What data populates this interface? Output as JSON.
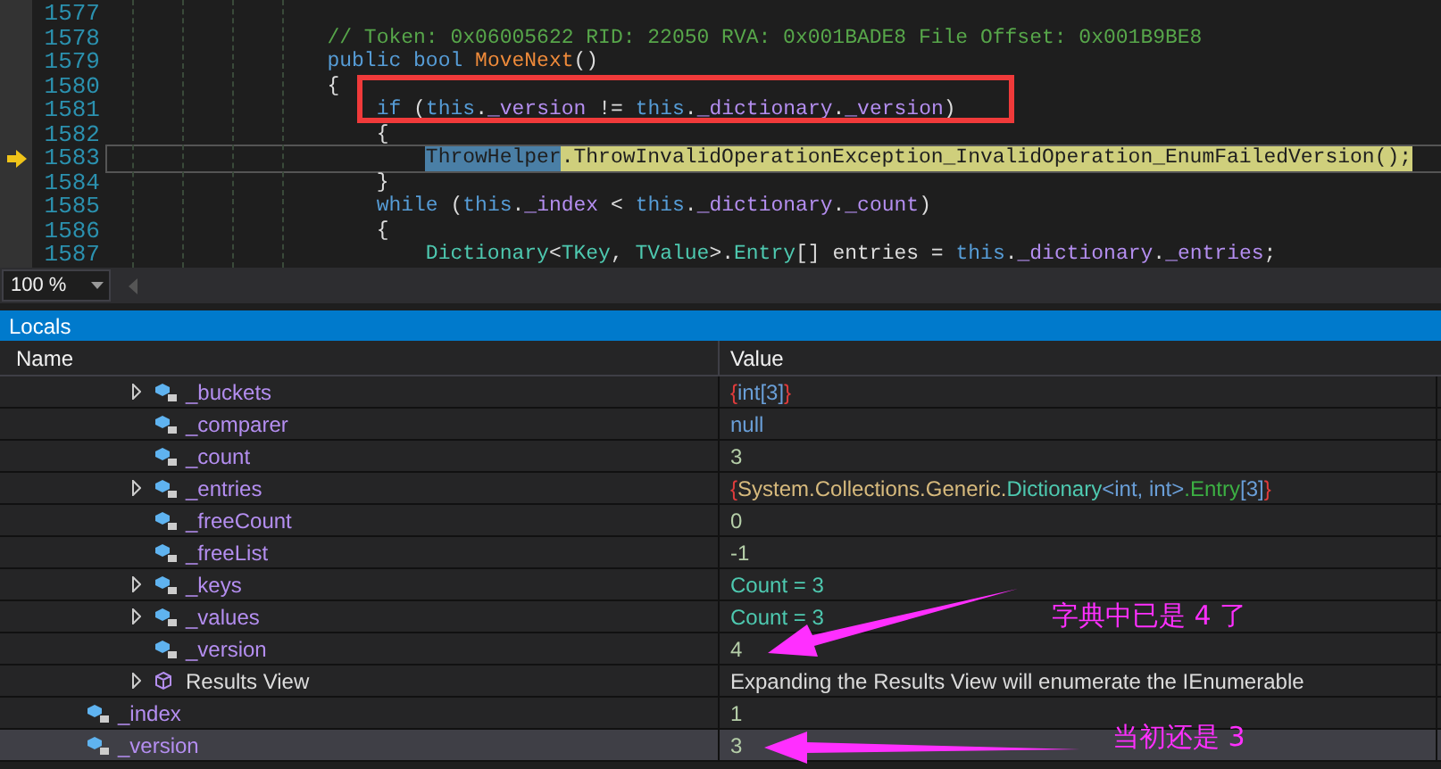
{
  "editor": {
    "lines": [
      {
        "number": "1577"
      },
      {
        "number": "1578",
        "tokens": [
          {
            "text": "        // Token: 0x06005622 RID: 22050 RVA: 0x001BADE8 File Offset: 0x001B9BE8",
            "kind": "comment"
          }
        ]
      },
      {
        "number": "1579",
        "tokens": [
          {
            "text": "        public bool ",
            "kind": "keyword"
          },
          {
            "text": "MoveNext",
            "kind": "method"
          },
          {
            "text": "()",
            "kind": "punct"
          }
        ]
      },
      {
        "number": "1580",
        "tokens": [
          {
            "text": "        {",
            "kind": "punct"
          }
        ]
      },
      {
        "number": "1581",
        "tokens": [
          {
            "text": "            if",
            "kind": "keyword"
          },
          {
            "text": " (",
            "kind": "punct"
          },
          {
            "text": "this",
            "kind": "keyword"
          },
          {
            "text": ".",
            "kind": "punct"
          },
          {
            "text": "_version",
            "kind": "field"
          },
          {
            "text": " != ",
            "kind": "punct"
          },
          {
            "text": "this",
            "kind": "keyword"
          },
          {
            "text": ".",
            "kind": "punct"
          },
          {
            "text": "_dictionary",
            "kind": "field"
          },
          {
            "text": ".",
            "kind": "punct"
          },
          {
            "text": "_version",
            "kind": "field"
          },
          {
            "text": ")",
            "kind": "punct"
          }
        ]
      },
      {
        "number": "1582",
        "tokens": [
          {
            "text": "            {",
            "kind": "punct"
          }
        ]
      },
      {
        "number": "1583",
        "current": true,
        "tokens": [
          {
            "text": "                ThrowHelper",
            "kind": "selected"
          },
          {
            "text": ".ThrowInvalidOperationException_InvalidOperation_EnumFailedVersion();",
            "kind": "current"
          }
        ]
      },
      {
        "number": "1584",
        "tokens": [
          {
            "text": "            }",
            "kind": "punct"
          }
        ]
      },
      {
        "number": "1585",
        "tokens": [
          {
            "text": "            while",
            "kind": "keyword"
          },
          {
            "text": " (",
            "kind": "punct"
          },
          {
            "text": "this",
            "kind": "keyword"
          },
          {
            "text": ".",
            "kind": "punct"
          },
          {
            "text": "_index",
            "kind": "field"
          },
          {
            "text": " < ",
            "kind": "punct"
          },
          {
            "text": "this",
            "kind": "keyword"
          },
          {
            "text": ".",
            "kind": "punct"
          },
          {
            "text": "_dictionary",
            "kind": "field"
          },
          {
            "text": ".",
            "kind": "punct"
          },
          {
            "text": "_count",
            "kind": "field"
          },
          {
            "text": ")",
            "kind": "punct"
          }
        ]
      },
      {
        "number": "1586",
        "tokens": [
          {
            "text": "            {",
            "kind": "punct"
          }
        ]
      },
      {
        "number": "1587",
        "tokens": [
          {
            "text": "                Dictionary",
            "kind": "type"
          },
          {
            "text": "<",
            "kind": "punct"
          },
          {
            "text": "TKey",
            "kind": "type"
          },
          {
            "text": ", ",
            "kind": "punct"
          },
          {
            "text": "TValue",
            "kind": "type"
          },
          {
            "text": ">.",
            "kind": "punct"
          },
          {
            "text": "Entry",
            "kind": "type"
          },
          {
            "text": "[] entries = ",
            "kind": "punct"
          },
          {
            "text": "this",
            "kind": "keyword"
          },
          {
            "text": ".",
            "kind": "punct"
          },
          {
            "text": "_dictionary",
            "kind": "field"
          },
          {
            "text": ".",
            "kind": "punct"
          },
          {
            "text": "_entries",
            "kind": "field"
          },
          {
            "text": ";",
            "kind": "punct"
          }
        ]
      }
    ],
    "zoom": "100 %"
  },
  "locals": {
    "title": "Locals",
    "columns": [
      "Name",
      "Value"
    ],
    "rows": [
      {
        "kind": "scrolled_parent",
        "children": [
          {
            "name": "_buckets",
            "kind": "field",
            "expandable": true,
            "value": [
              {
                "text": "{",
                "kind": "brace"
              },
              {
                "text": "int[3]",
                "kind": "keyword"
              },
              {
                "text": "}",
                "kind": "brace"
              }
            ]
          },
          {
            "name": "_comparer",
            "kind": "field",
            "expandable": false,
            "value": [
              {
                "text": "null",
                "kind": "keyword"
              }
            ]
          },
          {
            "name": "_count",
            "kind": "field",
            "expandable": false,
            "value": [
              {
                "text": "3",
                "kind": "number"
              }
            ]
          },
          {
            "name": "_entries",
            "kind": "field",
            "expandable": true,
            "value": [
              {
                "text": "{",
                "kind": "brace"
              },
              {
                "text": "System.Collections.Generic.",
                "kind": "namespace"
              },
              {
                "text": "Dictionary",
                "kind": "type"
              },
              {
                "text": "<int, int>",
                "kind": "keyword"
              },
              {
                "text": ".Entry",
                "kind": "struct"
              },
              {
                "text": "[3]",
                "kind": "keyword"
              },
              {
                "text": "}",
                "kind": "brace"
              }
            ]
          },
          {
            "name": "_freeCount",
            "kind": "field",
            "expandable": false,
            "value": [
              {
                "text": "0",
                "kind": "number"
              }
            ]
          },
          {
            "name": "_freeList",
            "kind": "field",
            "expandable": false,
            "value": [
              {
                "text": "-1",
                "kind": "number"
              }
            ]
          },
          {
            "name": "_keys",
            "kind": "field",
            "expandable": true,
            "value": [
              {
                "text": "Count = 3",
                "kind": "type"
              }
            ]
          },
          {
            "name": "_values",
            "kind": "field",
            "expandable": true,
            "value": [
              {
                "text": "Count = 3",
                "kind": "type"
              }
            ]
          },
          {
            "name": "_version",
            "kind": "field",
            "expandable": false,
            "value": [
              {
                "text": "4",
                "kind": "number"
              }
            ]
          },
          {
            "name": "Results View",
            "kind": "results_view",
            "expandable": true,
            "value": [
              {
                "text": "Expanding the Results View will enumerate the IEnumerable",
                "kind": "plain"
              }
            ]
          }
        ]
      },
      {
        "name": "_index",
        "kind": "field",
        "expandable": false,
        "selected": false,
        "value": [
          {
            "text": "1",
            "kind": "number"
          }
        ]
      },
      {
        "name": "_version",
        "kind": "field",
        "expandable": false,
        "selected": true,
        "value": [
          {
            "text": "3",
            "kind": "number"
          }
        ]
      }
    ]
  },
  "annotations": [
    {
      "text": "字典中已是 4 了"
    },
    {
      "text": "当初还是 3"
    }
  ]
}
